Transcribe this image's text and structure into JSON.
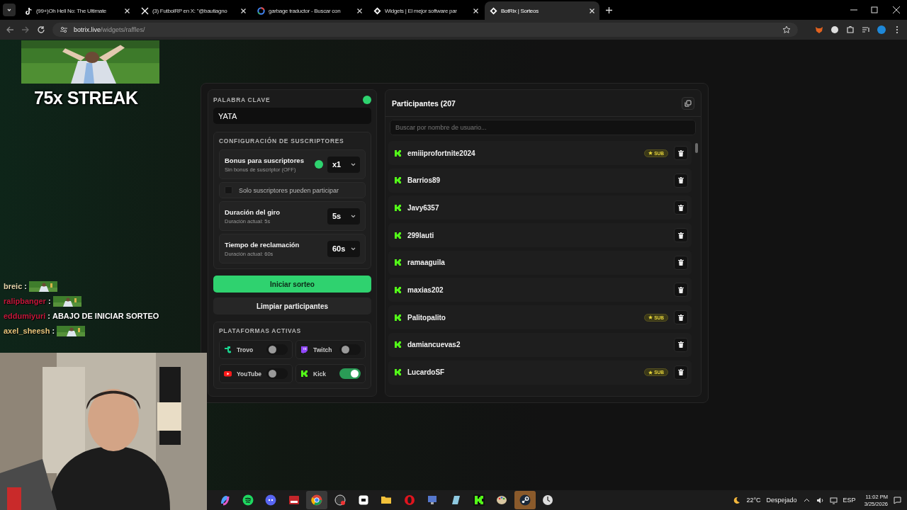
{
  "browser": {
    "tabs": [
      {
        "kind": "tiktok",
        "title": "(99+)Oh Hell No: The Ultimate",
        "selected": false
      },
      {
        "kind": "x",
        "title": "(3) FutbolRP en X: \"@bautiagno",
        "selected": false
      },
      {
        "kind": "google",
        "title": "garbage traductor - Buscar con",
        "selected": false
      },
      {
        "kind": "diamond",
        "title": "Widgets | El mejor software par",
        "selected": false
      },
      {
        "kind": "diamond",
        "title": "BotRix | Sorteos",
        "selected": true
      }
    ],
    "address": {
      "host": "botrix.live",
      "path": "/widgets/raffles/"
    }
  },
  "overlay": {
    "streak": "75x STREAK",
    "chat": [
      {
        "user": "breic",
        "separator": ":",
        "color": "#e6d5ab",
        "kind": "emote"
      },
      {
        "user": "ralipbanger",
        "separator": ":",
        "color": "#c4163a",
        "kind": "emote"
      },
      {
        "user": "eddumiyuri",
        "separator": ":",
        "color": "#c4163a",
        "kind": "text",
        "message": "ABAJO DE INICIAR SORTEO"
      },
      {
        "user": "axel_sheesh",
        "separator": ":",
        "color": "#e6c27a",
        "kind": "emote"
      }
    ]
  },
  "raffle": {
    "keyword": {
      "label": "PALABRA CLAVE",
      "value": "YATA"
    },
    "subscribers": {
      "title": "CONFIGURACIÓN DE SUSCRIPTORES",
      "bonus": {
        "title": "Bonus para suscriptores",
        "subtitle": "Sin bonus de suscriptor (OFF)",
        "value": "x1"
      },
      "only_subs": {
        "label": "Solo suscriptores pueden participar",
        "checked": false
      },
      "spin": {
        "title": "Duración del giro",
        "subtitle": "Duración actual: 5s",
        "value": "5s"
      },
      "claim": {
        "title": "Tiempo de reclamación",
        "subtitle": "Duración actual: 60s",
        "value": "60s"
      }
    },
    "buttons": [
      {
        "kind": "primary",
        "label": "Iniciar sorteo"
      },
      {
        "kind": "secondary",
        "label": "Limpiar participantes"
      }
    ],
    "platforms": {
      "title": "PLATAFORMAS ACTIVAS",
      "items": [
        {
          "kind": "trovo",
          "name": "Trovo",
          "on": false
        },
        {
          "kind": "twitch",
          "name": "Twitch",
          "on": false
        },
        {
          "kind": "youtube",
          "name": "YouTube",
          "on": false
        },
        {
          "kind": "kick",
          "name": "Kick",
          "on": true
        }
      ]
    }
  },
  "participants": {
    "title": "Participantes (207",
    "search": {
      "placeholder": "Buscar por nombre de usuario..."
    },
    "rows": [
      {
        "name": "emiiiprofortnite2024",
        "badge": "SUB"
      },
      {
        "name": "Barrios89"
      },
      {
        "name": "Javy6357"
      },
      {
        "name": "299lauti"
      },
      {
        "name": "ramaaguila"
      },
      {
        "name": "maxias202"
      },
      {
        "name": "Palitopalito",
        "badge": "SUB"
      },
      {
        "name": "damiancuevas2"
      },
      {
        "name": "LucardoSF",
        "badge": "SUB"
      }
    ]
  },
  "taskbar": {
    "apps": [
      {
        "selected": false
      },
      {
        "selected": false
      },
      {
        "selected": false
      },
      {
        "selected": false
      },
      {
        "selected": true
      },
      {
        "selected": false
      },
      {
        "selected": false
      },
      {
        "selected": false
      },
      {
        "selected": false
      },
      {
        "selected": false
      },
      {
        "selected": false
      },
      {
        "selected": false
      },
      {
        "selected": false
      },
      {
        "selected": true
      },
      {
        "selected": false
      }
    ],
    "weather": {
      "temp": "22°C",
      "sky": "Despejado"
    },
    "language": "ESP",
    "time": "11:02 PM",
    "date": "3/25/2026"
  }
}
